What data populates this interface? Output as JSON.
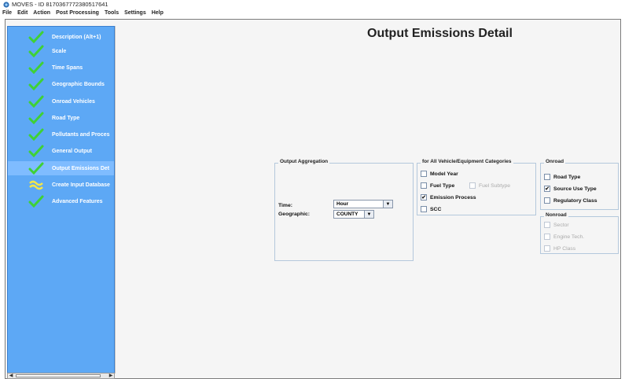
{
  "window": {
    "title": "MOVES - ID 8170367772380517641"
  },
  "menu": [
    "File",
    "Edit",
    "Action",
    "Post Processing",
    "Tools",
    "Settings",
    "Help"
  ],
  "sidebar": {
    "items": [
      {
        "label": "Description (Alt+1)",
        "icon": "check-icon",
        "selected": false
      },
      {
        "label": "Scale",
        "icon": "check-icon",
        "selected": false
      },
      {
        "label": "Time Spans",
        "icon": "check-icon",
        "selected": false
      },
      {
        "label": "Geographic Bounds",
        "icon": "check-icon",
        "selected": false
      },
      {
        "label": "Onroad Vehicles",
        "icon": "check-icon",
        "selected": false
      },
      {
        "label": "Road Type",
        "icon": "check-icon",
        "selected": false
      },
      {
        "label": "Pollutants and Proces",
        "icon": "check-icon",
        "selected": false
      },
      {
        "label": "General Output",
        "icon": "check-icon",
        "selected": false
      },
      {
        "label": "Output Emissions Det",
        "icon": "check-icon",
        "selected": true
      },
      {
        "label": "Create Input Database",
        "icon": "tilde-icon",
        "selected": false
      },
      {
        "label": "Advanced Features",
        "icon": "check-icon",
        "selected": false
      }
    ]
  },
  "main": {
    "title": "Output Emissions Detail",
    "aggregation": {
      "title": "Output Aggregation",
      "time_label": "Time:",
      "time_value": "Hour",
      "geo_label": "Geographic:",
      "geo_value": "COUNTY"
    },
    "categories": {
      "title": "for All Vehicle/Equipment Categories",
      "model_year": {
        "label": "Model Year",
        "checked": false
      },
      "fuel_type": {
        "label": "Fuel Type",
        "checked": false
      },
      "fuel_subtype": {
        "label": "Fuel Subtype",
        "checked": false,
        "enabled": false
      },
      "emission_process": {
        "label": "Emission Process",
        "checked": true
      },
      "scc": {
        "label": "SCC",
        "checked": false
      }
    },
    "onroad": {
      "title": "Onroad",
      "road_type": {
        "label": "Road Type",
        "checked": false
      },
      "source_use_type": {
        "label": "Source Use Type",
        "checked": true
      },
      "regulatory_class": {
        "label": "Regulatory Class",
        "checked": false
      }
    },
    "nonroad": {
      "title": "Nonroad",
      "sector": {
        "label": "Sector",
        "checked": false,
        "enabled": false
      },
      "engine_tech": {
        "label": "Engine Tech.",
        "checked": false,
        "enabled": false
      },
      "hp_class": {
        "label": "HP Class",
        "checked": false,
        "enabled": false
      }
    }
  },
  "colors": {
    "sidebar": "#5da8f5",
    "check": "#3fd135",
    "tilde": "#f2e64a"
  }
}
